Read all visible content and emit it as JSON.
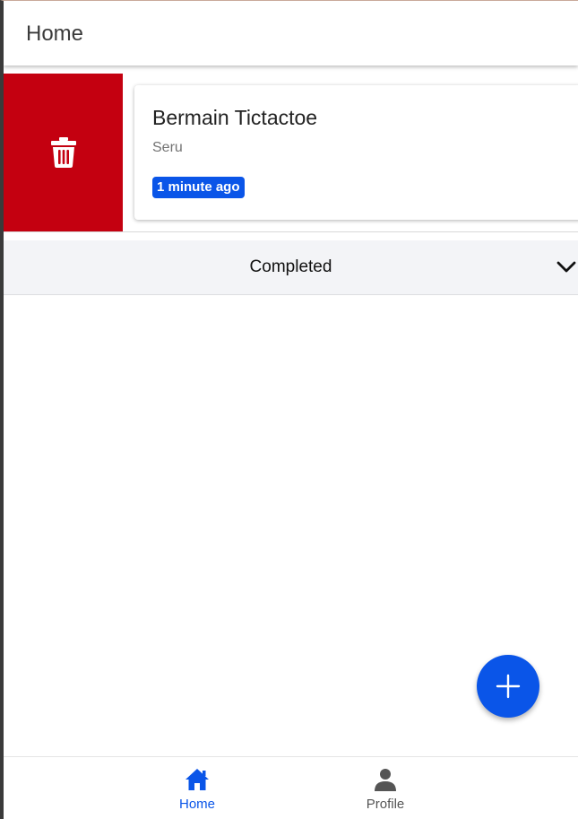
{
  "header": {
    "title": "Home"
  },
  "task": {
    "title": "Bermain Tictactoe",
    "subtitle": "Seru",
    "badge": "1 minute ago"
  },
  "completed_section": {
    "label": "Completed"
  },
  "bottom_nav": {
    "items": [
      {
        "label": "Home",
        "icon": "home-icon",
        "active": true
      },
      {
        "label": "Profile",
        "icon": "person-icon",
        "active": false
      }
    ]
  },
  "colors": {
    "accent": "#0a55e8",
    "delete": "#c40010",
    "section_bg": "#f3f4f7"
  }
}
